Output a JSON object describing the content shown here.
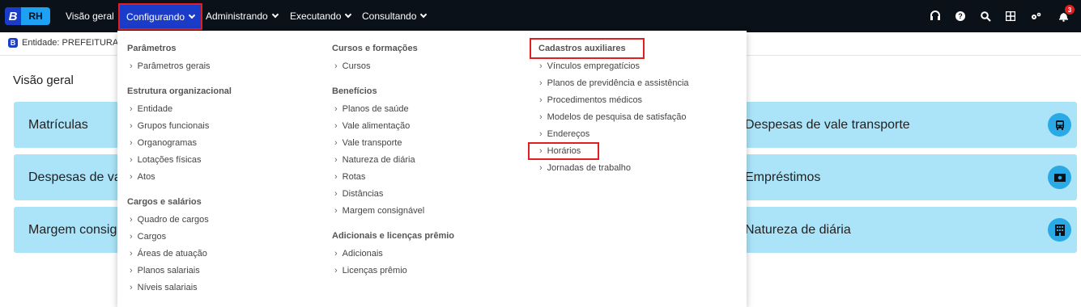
{
  "app": {
    "logo_letter": "B",
    "logo_text": "RH"
  },
  "nav": {
    "items": [
      {
        "label": "Visão geral",
        "has_chevron": false
      },
      {
        "label": "Configurando",
        "has_chevron": true,
        "active": true
      },
      {
        "label": "Administrando",
        "has_chevron": true
      },
      {
        "label": "Executando",
        "has_chevron": true
      },
      {
        "label": "Consultando",
        "has_chevron": true
      }
    ],
    "icons": [
      "support-icon",
      "help-icon",
      "search-icon",
      "apps-grid-icon",
      "settings-icon",
      "notifications-icon"
    ],
    "notification_count": "3"
  },
  "entity": {
    "badge": "B",
    "text": "Entidade: PREFEITURA D"
  },
  "page": {
    "title": "Visão geral"
  },
  "cards_left": [
    "Matrículas",
    "Despesas de val",
    "Margem consig"
  ],
  "cards_right": [
    {
      "label": "Despesas de vale transporte",
      "icon": "bus-icon"
    },
    {
      "label": "Empréstimos",
      "icon": "cash-icon"
    },
    {
      "label": "Natureza de diária",
      "icon": "building-icon"
    }
  ],
  "menu": {
    "col1": [
      {
        "title": "Parâmetros",
        "items": [
          "Parâmetros gerais"
        ]
      },
      {
        "title": "Estrutura organizacional",
        "items": [
          "Entidade",
          "Grupos funcionais",
          "Organogramas",
          "Lotações físicas",
          "Atos"
        ]
      },
      {
        "title": "Cargos e salários",
        "items": [
          "Quadro de cargos",
          "Cargos",
          "Áreas de atuação",
          "Planos salariais",
          "Níveis salariais"
        ]
      }
    ],
    "col2": [
      {
        "title": "Cursos e formações",
        "items": [
          "Cursos"
        ]
      },
      {
        "title": "Benefícios",
        "items": [
          "Planos de saúde",
          "Vale alimentação",
          "Vale transporte",
          "Natureza de diária",
          "Rotas",
          "Distâncias",
          "Margem consignável"
        ]
      },
      {
        "title": "Adicionais e licenças prêmio",
        "items": [
          "Adicionais",
          "Licenças prêmio"
        ]
      }
    ],
    "col3": [
      {
        "title": "Cadastros auxiliares",
        "items": [
          "Vínculos empregatícios",
          "Planos de previdência e assistência",
          "Procedimentos médicos",
          "Modelos de pesquisa de satisfação",
          "Endereços",
          "Horários",
          "Jornadas de trabalho"
        ]
      }
    ],
    "arrow": "›"
  },
  "colors": {
    "topbar": "#0b1118",
    "accent": "#1a3cc8",
    "card": "#abe3f8",
    "highlight": "#e02020"
  }
}
